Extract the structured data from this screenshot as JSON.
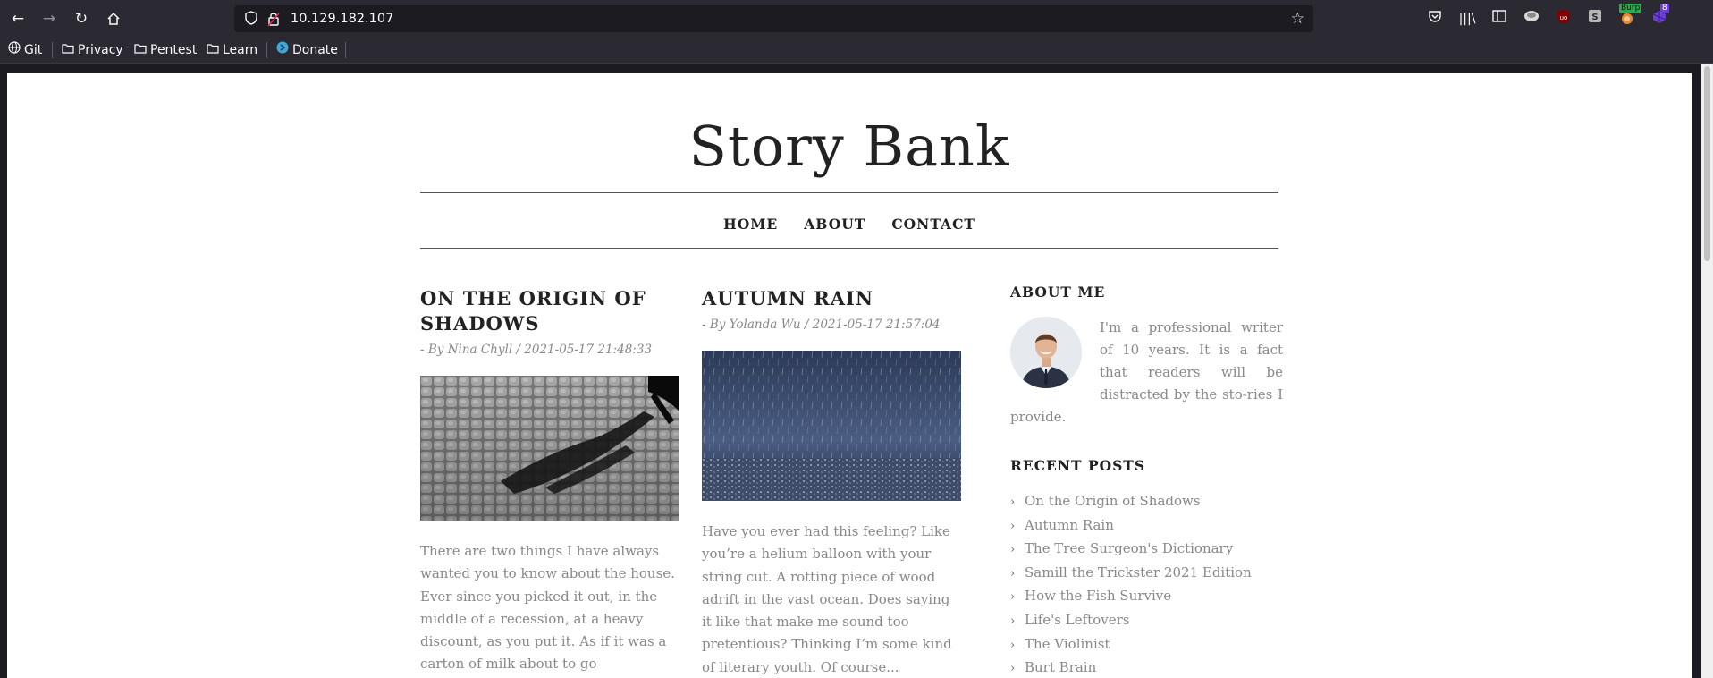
{
  "browser": {
    "url": "10.129.182.107",
    "bookmarks": [
      {
        "label": "Git",
        "icon": "globe-icon"
      },
      {
        "label": "Privacy",
        "icon": "folder-icon"
      },
      {
        "label": "Pentest",
        "icon": "folder-icon"
      },
      {
        "label": "Learn",
        "icon": "folder-icon"
      },
      {
        "label": "Donate",
        "icon": "donate-icon"
      }
    ],
    "extensions": {
      "burp_badge": "Burp",
      "count_badge": "8"
    }
  },
  "site": {
    "title": "Story Bank",
    "nav": [
      "HOME",
      "ABOUT",
      "CONTACT"
    ]
  },
  "posts": [
    {
      "title": "ON THE ORIGIN OF SHADOWS",
      "meta": "- By Nina Chyll / 2021-05-17 21:48:33",
      "excerpt": "There are two things I have always wanted you to know about the house. Ever since you picked it out, in the middle of a recession, at a heavy discount, as you put it. As if it was a carton of milk about to go"
    },
    {
      "title": "AUTUMN RAIN",
      "meta": "- By Yolanda Wu / 2021-05-17 21:57:04",
      "excerpt": "Have you ever had this feeling? Like you’re a helium balloon with your string cut. A rotting piece of wood adrift in the vast ocean. Does saying it like that make me sound too pretentious? Thinking I’m some kind of literary youth. Of course..."
    }
  ],
  "sidebar": {
    "about_title": "ABOUT ME",
    "about_text": "I'm a professional writer of 10 years. It is a fact that readers will be distracted by the sto-ries I provide.",
    "recent_title": "RECENT POSTS",
    "recent_posts": [
      "On the Origin of Shadows",
      "Autumn Rain",
      "The Tree Surgeon's Dictionary",
      "Samill the Trickster 2021 Edition",
      "How the Fish Survive",
      "Life's Leftovers",
      "The Violinist",
      "Burt Brain"
    ]
  }
}
